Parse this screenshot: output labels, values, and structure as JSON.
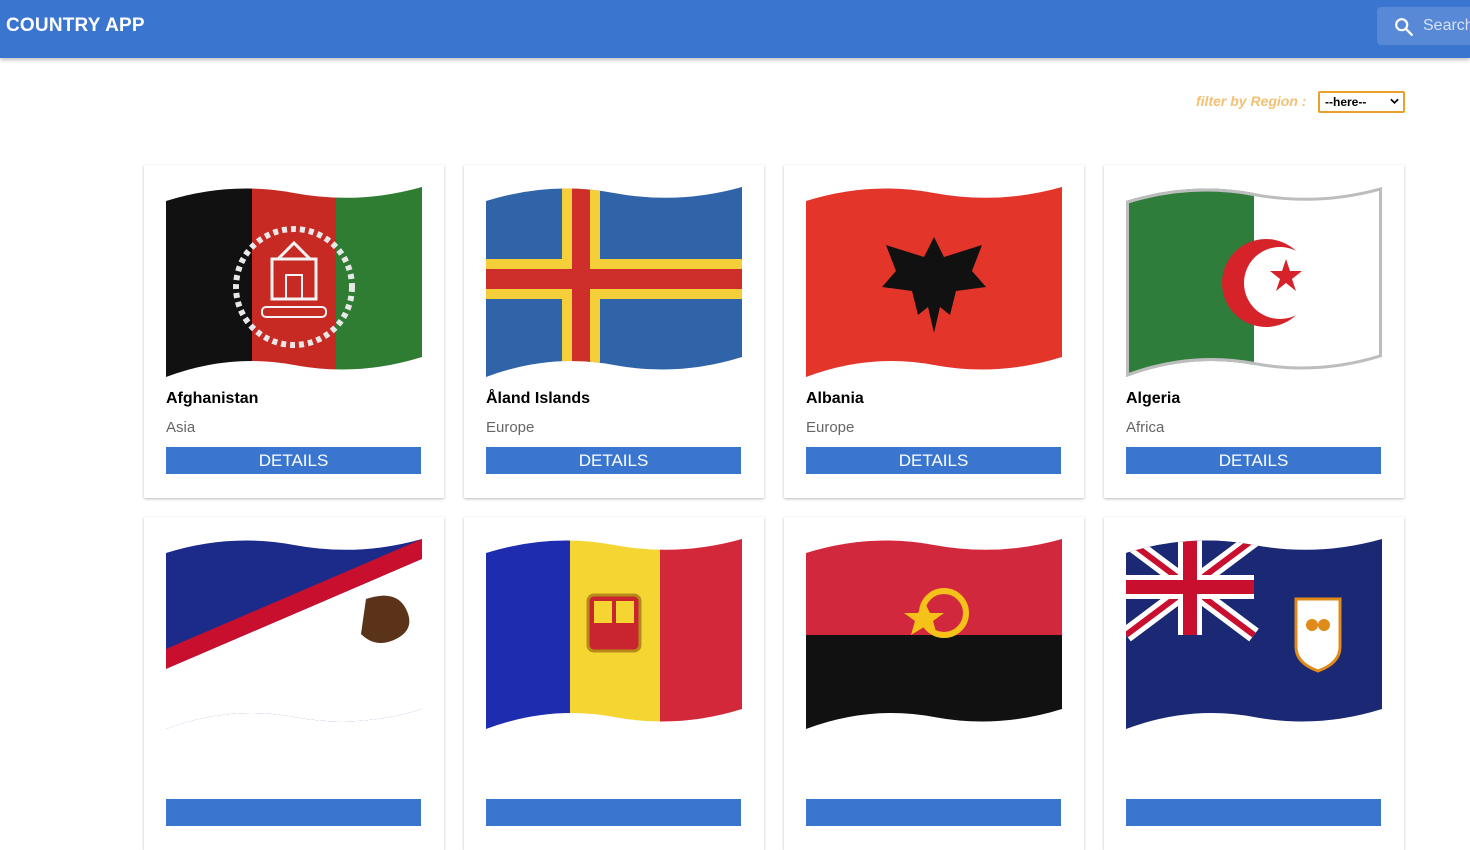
{
  "appbar": {
    "title": "COUNTRY APP",
    "search_placeholder": "Search…",
    "search_icon": "search-icon",
    "color": "#3a75cf"
  },
  "filter": {
    "label": "filter by Region :",
    "selected": "--here--"
  },
  "countries": [
    {
      "name": "Afghanistan",
      "region": "Asia",
      "button": "DETAILS"
    },
    {
      "name": "Åland Islands",
      "region": "Europe",
      "button": "DETAILS"
    },
    {
      "name": "Albania",
      "region": "Europe",
      "button": "DETAILS"
    },
    {
      "name": "Algeria",
      "region": "Africa",
      "button": "DETAILS"
    },
    {
      "name": "",
      "region": "",
      "button": ""
    },
    {
      "name": "",
      "region": "",
      "button": ""
    },
    {
      "name": "",
      "region": "",
      "button": ""
    },
    {
      "name": "",
      "region": "",
      "button": ""
    }
  ],
  "flags": [
    "afghanistan-flag",
    "aland-islands-flag",
    "albania-flag",
    "algeria-flag",
    "american-samoa-flag",
    "andorra-flag",
    "angola-flag",
    "anguilla-flag"
  ]
}
